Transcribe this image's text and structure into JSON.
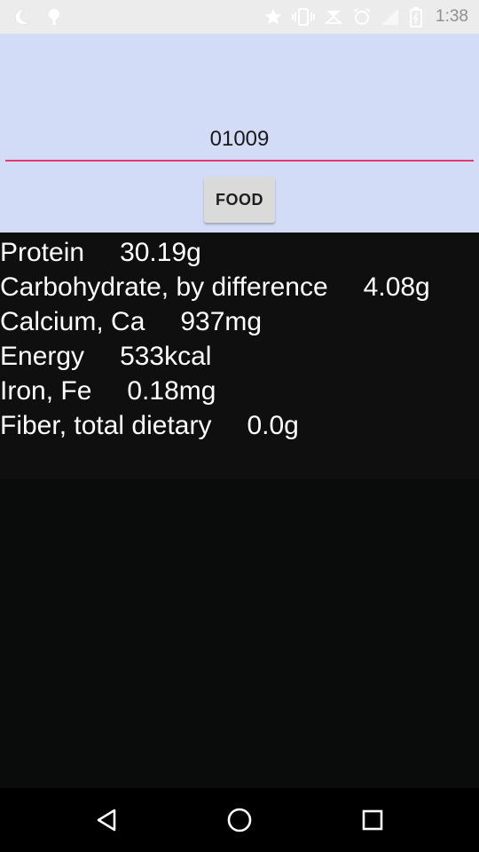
{
  "status_bar": {
    "time": "1:38",
    "left_icons": [
      "moon-icon",
      "android-icon"
    ],
    "right_icons": [
      "star-icon",
      "vibrate-icon",
      "data-transfer-icon",
      "alarm-icon",
      "signal-icon",
      "battery-icon"
    ]
  },
  "input": {
    "value": "01009"
  },
  "food_button": {
    "label": "FOOD"
  },
  "nutrients": [
    {
      "name": "Protein",
      "value": "30.19g"
    },
    {
      "name": "Carbohydrate, by difference",
      "value": "4.08g"
    },
    {
      "name": "Calcium, Ca",
      "value": "937mg"
    },
    {
      "name": "Energy",
      "value": "533kcal"
    },
    {
      "name": "Iron, Fe",
      "value": "0.18mg"
    },
    {
      "name": "Fiber, total dietary",
      "value": "0.0g"
    }
  ],
  "nav": {
    "icons": [
      "back-icon",
      "home-icon",
      "recents-icon"
    ]
  },
  "colors": {
    "panel_bg": "#d3dcf7",
    "accent_underline": "#e53a6f",
    "list_bg": "#0f0f0f",
    "nav_bg": "#000000"
  }
}
